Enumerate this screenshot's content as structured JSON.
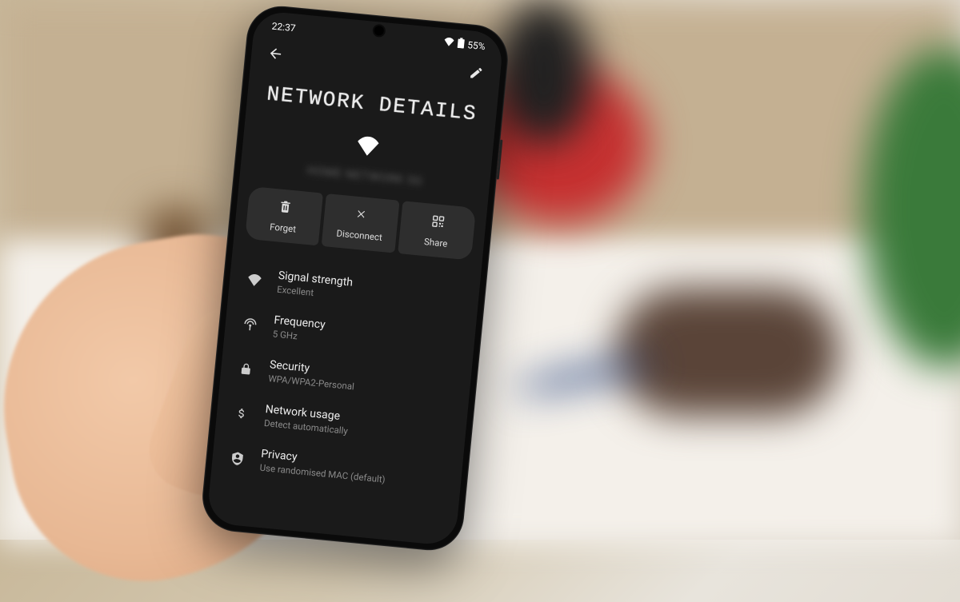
{
  "status": {
    "time": "22:37",
    "battery": "55%"
  },
  "page": {
    "title": "NETWORK DETAILS",
    "ssid": "HOME NETWORK 5G"
  },
  "actions": {
    "forget": "Forget",
    "disconnect": "Disconnect",
    "share": "Share"
  },
  "details": [
    {
      "icon": "wifi",
      "title": "Signal strength",
      "sub": "Excellent"
    },
    {
      "icon": "frequency",
      "title": "Frequency",
      "sub": "5 GHz"
    },
    {
      "icon": "lock",
      "title": "Security",
      "sub": "WPA/WPA2-Personal"
    },
    {
      "icon": "dollar",
      "title": "Network usage",
      "sub": "Detect automatically"
    },
    {
      "icon": "privacy",
      "title": "Privacy",
      "sub": "Use randomised MAC (default)"
    }
  ]
}
